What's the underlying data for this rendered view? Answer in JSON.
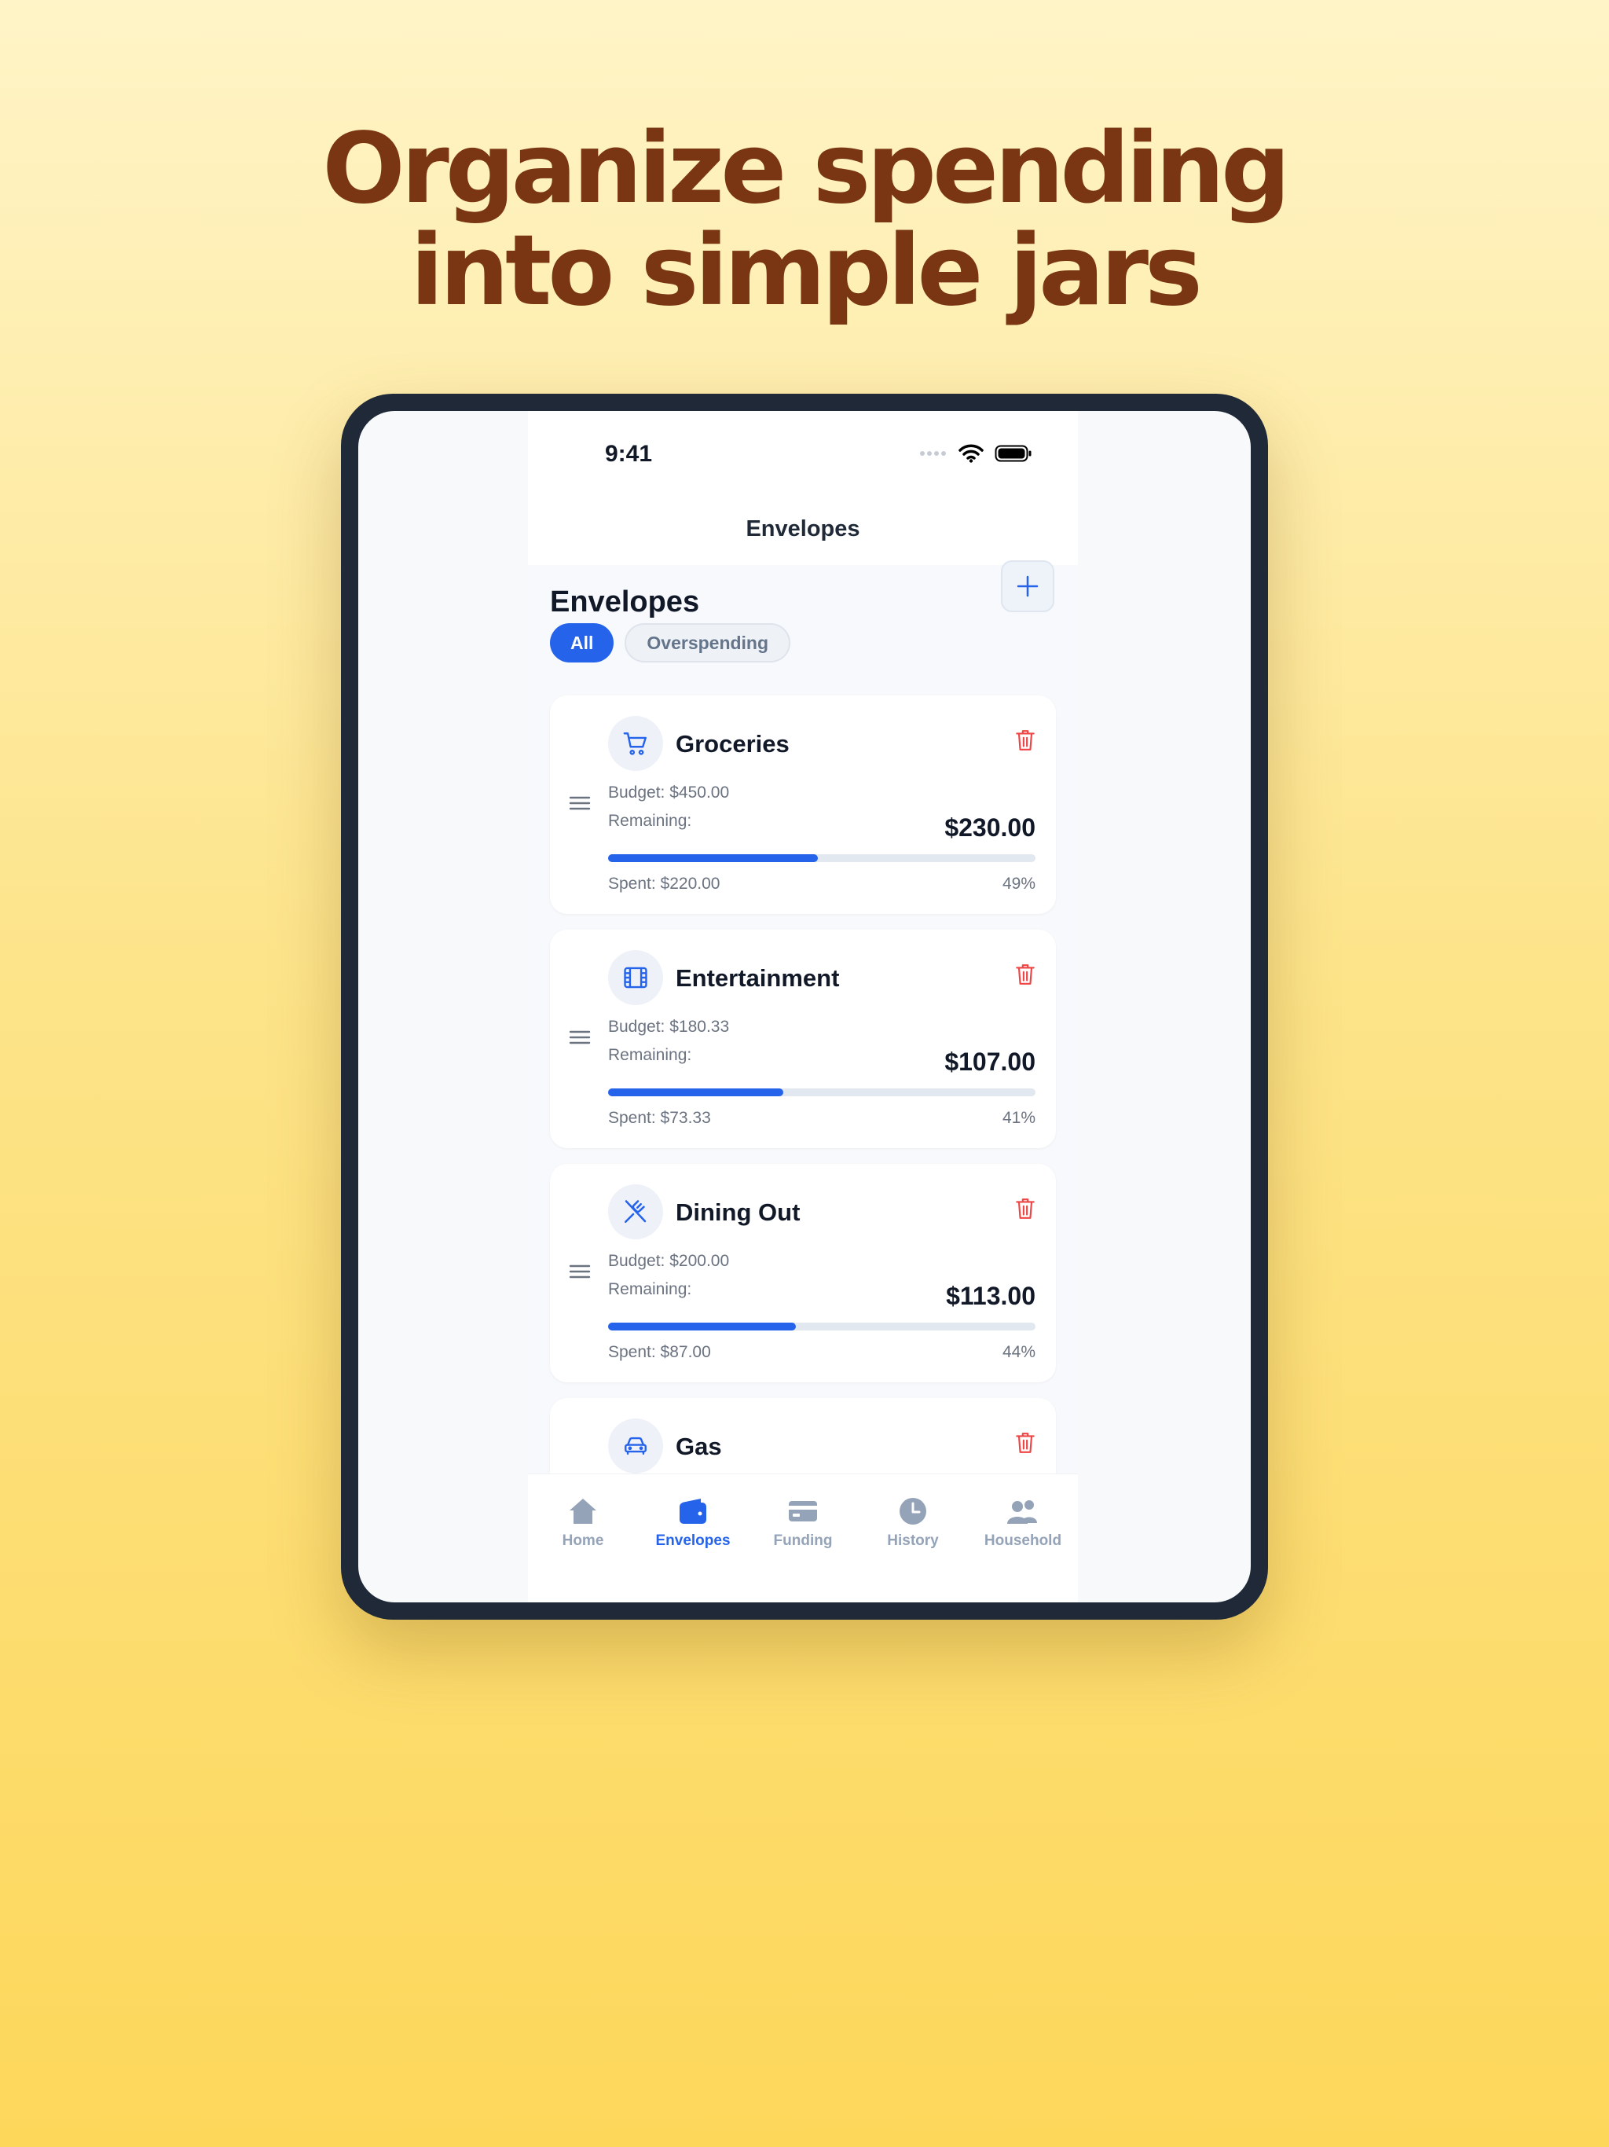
{
  "headline": {
    "line1": "Organize spending",
    "line2": "into simple jars"
  },
  "status_bar": {
    "time": "9:41"
  },
  "nav": {
    "title": "Envelopes"
  },
  "page": {
    "title": "Envelopes"
  },
  "filters": [
    {
      "label": "All",
      "active": true
    },
    {
      "label": "Overspending",
      "active": false
    }
  ],
  "envelopes": [
    {
      "name": "Groceries",
      "icon": "cart-icon",
      "budget": "Budget: $450.00",
      "remaining_label": "Remaining:",
      "remaining": "$230.00",
      "spent": "Spent: $220.00",
      "percent_label": "49%",
      "progress": 0.49
    },
    {
      "name": "Entertainment",
      "icon": "film-icon",
      "budget": "Budget: $180.33",
      "remaining_label": "Remaining:",
      "remaining": "$107.00",
      "spent": "Spent: $73.33",
      "percent_label": "41%",
      "progress": 0.41
    },
    {
      "name": "Dining Out",
      "icon": "utensils-icon",
      "budget": "Budget: $200.00",
      "remaining_label": "Remaining:",
      "remaining": "$113.00",
      "spent": "Spent: $87.00",
      "percent_label": "44%",
      "progress": 0.44
    },
    {
      "name": "Gas",
      "icon": "car-icon"
    }
  ],
  "tabs": [
    {
      "label": "Home",
      "icon": "home-icon",
      "active": false
    },
    {
      "label": "Envelopes",
      "icon": "wallet-icon",
      "active": true
    },
    {
      "label": "Funding",
      "icon": "card-icon",
      "active": false
    },
    {
      "label": "History",
      "icon": "clock-icon",
      "active": false
    },
    {
      "label": "Household",
      "icon": "people-icon",
      "active": false
    }
  ],
  "colors": {
    "accent": "#2563eb",
    "headline": "#7a3613",
    "danger": "#ef4444",
    "muted": "#94a3b8"
  }
}
